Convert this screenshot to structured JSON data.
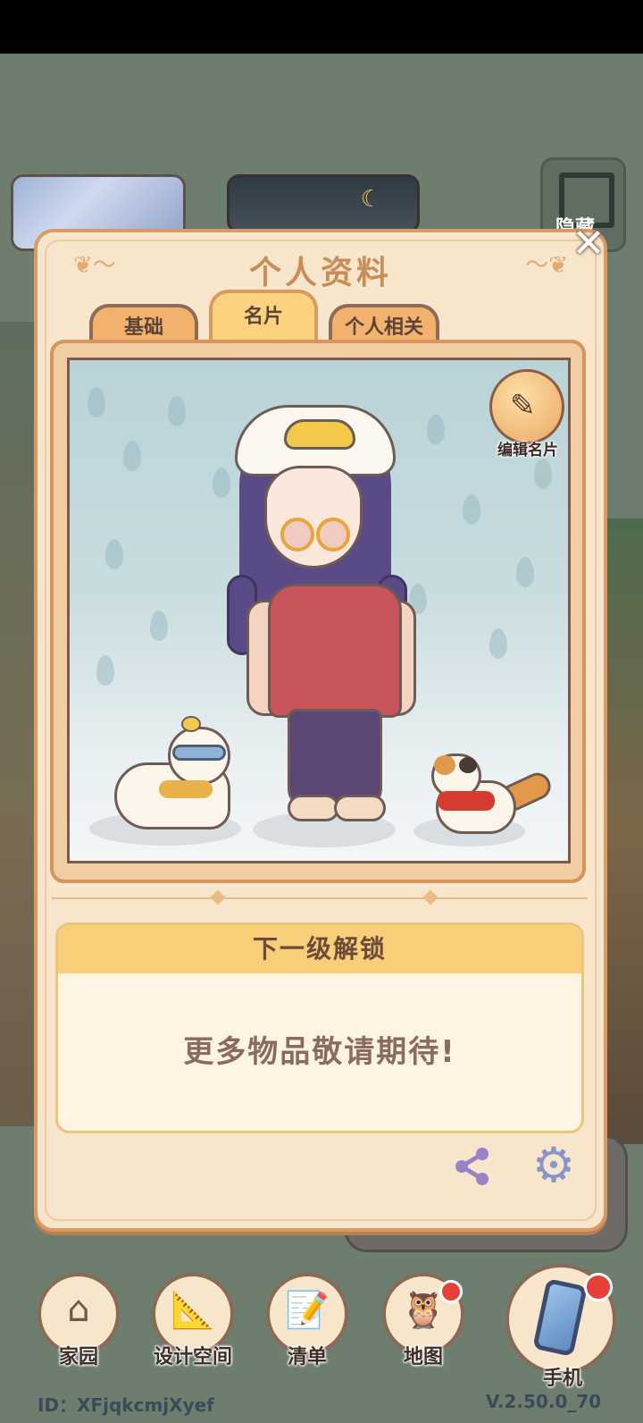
{
  "background": {
    "hide_label": "隐藏"
  },
  "panel": {
    "title": "个人资料",
    "tabs": [
      {
        "label": "基础"
      },
      {
        "label": "名片"
      },
      {
        "label": "个人相关"
      }
    ],
    "edit_card_label": "编辑名片",
    "unlock_header": "下一级解锁",
    "unlock_message": "更多物品敬请期待!"
  },
  "nav": {
    "items": [
      {
        "label": "家园",
        "icon": "house-icon"
      },
      {
        "label": "设计空间",
        "icon": "blueprint-icon"
      },
      {
        "label": "清单",
        "icon": "checklist-icon"
      },
      {
        "label": "地图",
        "icon": "owl-map-icon"
      }
    ],
    "phone_label": "手机"
  },
  "footer": {
    "id_text": "ID：XFjqkcmjXyef",
    "version": "V.2.50.0_70"
  },
  "colors": {
    "panel_bg": "#f7e6cc",
    "panel_border": "#d99a63",
    "title_color": "#c98d58",
    "notification": "#e5413a"
  }
}
